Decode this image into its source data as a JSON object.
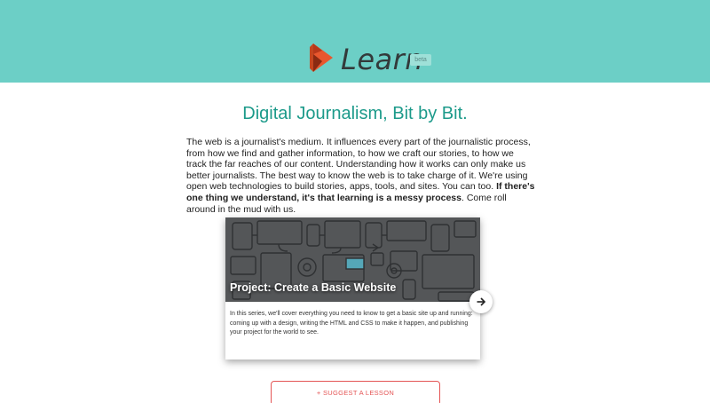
{
  "colors": {
    "header_bg": "#6ccfc6",
    "headline": "#1c9a8a",
    "logo": "#e8572e",
    "button_accent": "#e45555"
  },
  "header": {
    "brand": "Learn",
    "badge": "beta",
    "logo_icon": "orange-flag-logo-icon"
  },
  "headline": "Digital Journalism, Bit by Bit.",
  "intro": {
    "text": "The web is a journalist's medium. It influences every part of the journalistic process, from how we find and gather information, to how we craft our stories, to how we track the far reaches of our content. Understanding how it works can only make us better journalists. The best way to know the web is to take charge of it. We're using open web technologies to build stories, apps, tools, and sites. You can too. ",
    "bold": "If there's one thing we understand, it's that learning is a messy process",
    "tail": ". Come roll around in the mud with us."
  },
  "card": {
    "title": "Project: Create a Basic Website",
    "description": "In this series, we'll cover everything you need to know to get a basic site up and running: coming up with a design, writing the HTML and CSS to make it happen, and publishing your project for the world to see.",
    "image_icon": "tech-devices-illustration-icon",
    "next_icon": "arrow-right-icon"
  },
  "suggest_button": "+ SUGGEST A LESSON"
}
